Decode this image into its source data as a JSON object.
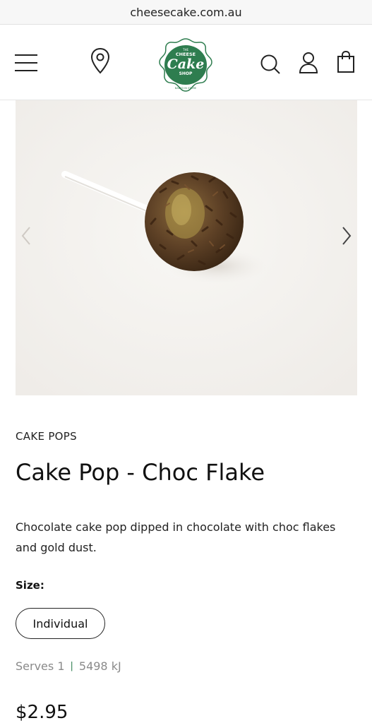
{
  "browser": {
    "url": "cheesecake.com.au"
  },
  "header": {
    "icons": [
      "hamburger-menu-icon",
      "location-pin-icon",
      "search-icon",
      "user-icon",
      "shopping-bag-icon"
    ],
    "logo": {
      "top": "THE",
      "line1": "CHEESE",
      "line2": "Cake",
      "line3": "SHOP",
      "tagline": "BAKED IN STORE"
    },
    "brand_color": "#2e7d4f"
  },
  "gallery": {
    "prev_icon": "chevron-left-icon",
    "next_icon": "chevron-right-icon"
  },
  "product": {
    "category": "CAKE POPS",
    "title": "Cake Pop - Choc Flake",
    "description": "Chocolate cake pop dipped in chocolate with choc flakes and gold dust.",
    "size_label": "Size:",
    "size_options": [
      "Individual"
    ],
    "serves": "Serves 1",
    "separator": "|",
    "energy": "5498 kJ",
    "price": "$2.95"
  }
}
